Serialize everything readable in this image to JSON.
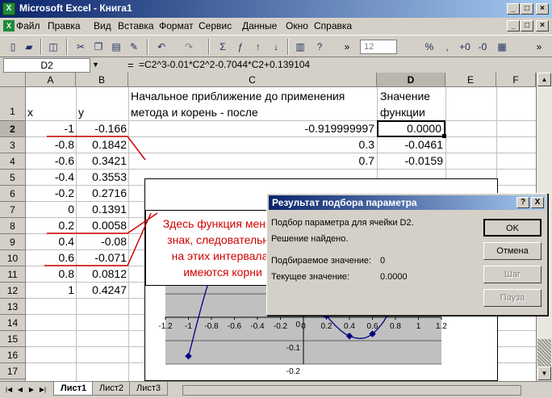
{
  "window": {
    "title": "Microsoft Excel - Книга1"
  },
  "menu": [
    "Файл",
    "Правка",
    "Вид",
    "Вставка",
    "Формат",
    "Сервис",
    "Данные",
    "Окно",
    "Справка"
  ],
  "toolbar": {
    "font_size": "12"
  },
  "formula_bar": {
    "name_box": "D2",
    "equals": "=",
    "formula": "=C2^3-0.01*C2^2-0.7044*C2+0.139104"
  },
  "columns": [
    "A",
    "B",
    "C",
    "D",
    "E",
    "F"
  ],
  "rows": [
    "1",
    "2",
    "3",
    "4",
    "5",
    "6",
    "7",
    "8",
    "9",
    "10",
    "11",
    "12",
    "13",
    "14",
    "15",
    "16",
    "17",
    "18"
  ],
  "headers": {
    "a1": "x",
    "b1": "y",
    "c1_line1": "Начальное приближение до применения",
    "c1_line2": "метода и корень - после",
    "d1_line1": "Значение",
    "d1_line2": "функции"
  },
  "data": [
    {
      "x": "-1",
      "y": "-0.166"
    },
    {
      "x": "-0.8",
      "y": "0.1842"
    },
    {
      "x": "-0.6",
      "y": "0.3421"
    },
    {
      "x": "-0.4",
      "y": "0.3553"
    },
    {
      "x": "-0.2",
      "y": "0.2716"
    },
    {
      "x": "0",
      "y": "0.1391"
    },
    {
      "x": "0.2",
      "y": "0.0058"
    },
    {
      "x": "0.4",
      "y": "-0.08"
    },
    {
      "x": "0.6",
      "y": "-0.071"
    },
    {
      "x": "0.8",
      "y": "0.0812"
    },
    {
      "x": "1",
      "y": "0.4247"
    }
  ],
  "col_c": [
    "-0.919999997",
    "0.3",
    "0.7"
  ],
  "col_d": [
    "0.0000",
    "-0.0461",
    "-0.0159"
  ],
  "callout": {
    "line1": "Здесь функция меняет",
    "line2": "знак, следовательно,",
    "line3": "на этих интервалах",
    "line4": "имеются корни"
  },
  "chart_data": {
    "type": "line",
    "x": [
      -1,
      -0.8,
      -0.6,
      -0.4,
      -0.2,
      0,
      0.2,
      0.4,
      0.6,
      0.8,
      1
    ],
    "y": [
      -0.166,
      0.1842,
      0.3421,
      0.3553,
      0.2716,
      0.1391,
      0.0058,
      -0.08,
      -0.071,
      0.0812,
      0.4247
    ],
    "x_ticks": [
      "-1.2",
      "-1",
      "-0.8",
      "-0.6",
      "-0.4",
      "-0.2",
      "0",
      "0.2",
      "0.4",
      "0.6",
      "0.8",
      "1",
      "1.2"
    ],
    "y_ticks": [
      "0",
      "-0.1",
      "-0.2"
    ],
    "xlim": [
      -1.2,
      1.2
    ],
    "ylim": [
      -0.2,
      0.4
    ]
  },
  "dialog": {
    "title": "Результат подбора параметра",
    "line1": "Подбор параметра для ячейки D2.",
    "line2": "Решение найдено.",
    "target_label": "Подбираемое значение:",
    "target_value": "0",
    "current_label": "Текущее значение:",
    "current_value": "0.0000",
    "ok": "OK",
    "cancel": "Отмена",
    "step": "Шаг",
    "pause": "Пауза",
    "help": "?",
    "close": "X"
  },
  "sheets": [
    "Лист1",
    "Лист2",
    "Лист3"
  ]
}
